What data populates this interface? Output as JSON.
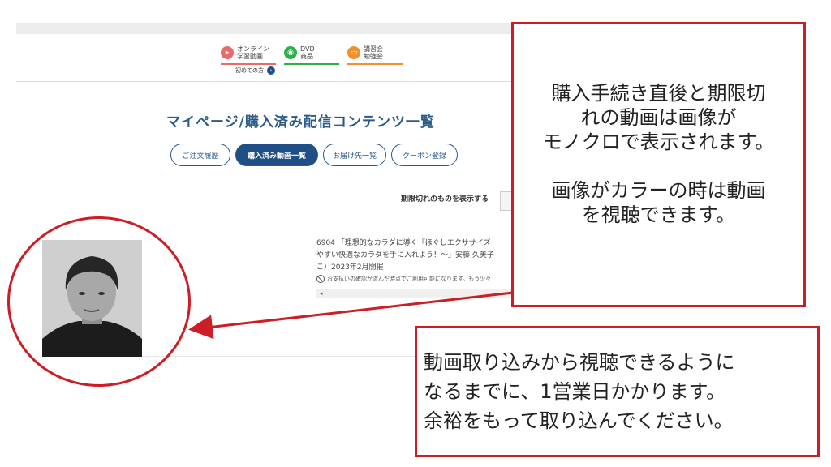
{
  "header": {
    "nav": [
      {
        "line1": "オンライン",
        "line2": "学習動画",
        "icon": "play-icon",
        "color": "#e86a6a"
      },
      {
        "line1": "DVD",
        "line2": "商品",
        "icon": "disc-icon",
        "color": "#2bb04a"
      },
      {
        "line1": "講習会",
        "line2": "勉強会",
        "icon": "chalkboard-icon",
        "color": "#f0922c"
      }
    ],
    "first_time_label": "初めての方"
  },
  "page": {
    "title": "マイページ/購入済み配信コンテンツ一覧",
    "tabs": [
      {
        "label": "ご注文履歴",
        "active": false
      },
      {
        "label": "購入済み動画一覧",
        "active": true
      },
      {
        "label": "お届け先一覧",
        "active": false
      },
      {
        "label": "クーポン登録",
        "active": false
      }
    ],
    "expired_toggle_label": "期限切れのものを表示する"
  },
  "item": {
    "line1": "6904 「理想的なカラダに導く『ほぐしエクササイズ",
    "line2": "やすい快適なカラダを手に入れよう！～」安藤 久美子",
    "line3": "こ）2023年2月開催",
    "notice": "お支払いの確認が済んだ時点でご利用可能になります。もう少々",
    "scroll_left": "◂"
  },
  "callouts": {
    "top": [
      "購入手続き直後と期限切",
      "れの動画は画像が",
      "モノクロで表示されます。",
      "",
      "画像がカラーの時は動画",
      "を視聴できます。"
    ],
    "bottom": [
      "動画取り込みから視聴できるように",
      "なるまでに、1営業日かかります。",
      "余裕をもって取り込んでください。"
    ]
  },
  "colors": {
    "accent_red": "#cc1e25",
    "navy": "#1f4f86"
  }
}
